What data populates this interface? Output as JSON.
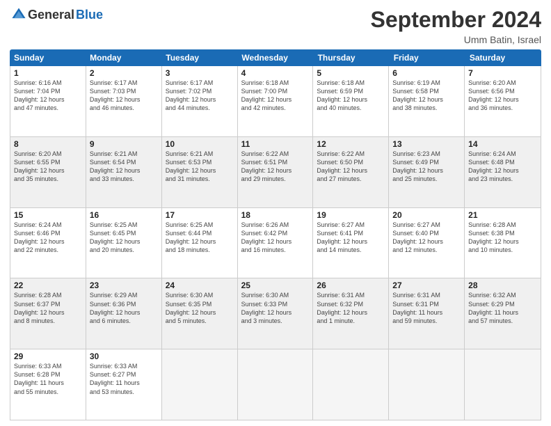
{
  "logo": {
    "general": "General",
    "blue": "Blue"
  },
  "title": "September 2024",
  "location": "Umm Batin, Israel",
  "header_days": [
    "Sunday",
    "Monday",
    "Tuesday",
    "Wednesday",
    "Thursday",
    "Friday",
    "Saturday"
  ],
  "rows": [
    [
      {
        "day": "1",
        "info": "Sunrise: 6:16 AM\nSunset: 7:04 PM\nDaylight: 12 hours\nand 47 minutes."
      },
      {
        "day": "2",
        "info": "Sunrise: 6:17 AM\nSunset: 7:03 PM\nDaylight: 12 hours\nand 46 minutes."
      },
      {
        "day": "3",
        "info": "Sunrise: 6:17 AM\nSunset: 7:02 PM\nDaylight: 12 hours\nand 44 minutes."
      },
      {
        "day": "4",
        "info": "Sunrise: 6:18 AM\nSunset: 7:00 PM\nDaylight: 12 hours\nand 42 minutes."
      },
      {
        "day": "5",
        "info": "Sunrise: 6:18 AM\nSunset: 6:59 PM\nDaylight: 12 hours\nand 40 minutes."
      },
      {
        "day": "6",
        "info": "Sunrise: 6:19 AM\nSunset: 6:58 PM\nDaylight: 12 hours\nand 38 minutes."
      },
      {
        "day": "7",
        "info": "Sunrise: 6:20 AM\nSunset: 6:56 PM\nDaylight: 12 hours\nand 36 minutes."
      }
    ],
    [
      {
        "day": "8",
        "info": "Sunrise: 6:20 AM\nSunset: 6:55 PM\nDaylight: 12 hours\nand 35 minutes."
      },
      {
        "day": "9",
        "info": "Sunrise: 6:21 AM\nSunset: 6:54 PM\nDaylight: 12 hours\nand 33 minutes."
      },
      {
        "day": "10",
        "info": "Sunrise: 6:21 AM\nSunset: 6:53 PM\nDaylight: 12 hours\nand 31 minutes."
      },
      {
        "day": "11",
        "info": "Sunrise: 6:22 AM\nSunset: 6:51 PM\nDaylight: 12 hours\nand 29 minutes."
      },
      {
        "day": "12",
        "info": "Sunrise: 6:22 AM\nSunset: 6:50 PM\nDaylight: 12 hours\nand 27 minutes."
      },
      {
        "day": "13",
        "info": "Sunrise: 6:23 AM\nSunset: 6:49 PM\nDaylight: 12 hours\nand 25 minutes."
      },
      {
        "day": "14",
        "info": "Sunrise: 6:24 AM\nSunset: 6:48 PM\nDaylight: 12 hours\nand 23 minutes."
      }
    ],
    [
      {
        "day": "15",
        "info": "Sunrise: 6:24 AM\nSunset: 6:46 PM\nDaylight: 12 hours\nand 22 minutes."
      },
      {
        "day": "16",
        "info": "Sunrise: 6:25 AM\nSunset: 6:45 PM\nDaylight: 12 hours\nand 20 minutes."
      },
      {
        "day": "17",
        "info": "Sunrise: 6:25 AM\nSunset: 6:44 PM\nDaylight: 12 hours\nand 18 minutes."
      },
      {
        "day": "18",
        "info": "Sunrise: 6:26 AM\nSunset: 6:42 PM\nDaylight: 12 hours\nand 16 minutes."
      },
      {
        "day": "19",
        "info": "Sunrise: 6:27 AM\nSunset: 6:41 PM\nDaylight: 12 hours\nand 14 minutes."
      },
      {
        "day": "20",
        "info": "Sunrise: 6:27 AM\nSunset: 6:40 PM\nDaylight: 12 hours\nand 12 minutes."
      },
      {
        "day": "21",
        "info": "Sunrise: 6:28 AM\nSunset: 6:38 PM\nDaylight: 12 hours\nand 10 minutes."
      }
    ],
    [
      {
        "day": "22",
        "info": "Sunrise: 6:28 AM\nSunset: 6:37 PM\nDaylight: 12 hours\nand 8 minutes."
      },
      {
        "day": "23",
        "info": "Sunrise: 6:29 AM\nSunset: 6:36 PM\nDaylight: 12 hours\nand 6 minutes."
      },
      {
        "day": "24",
        "info": "Sunrise: 6:30 AM\nSunset: 6:35 PM\nDaylight: 12 hours\nand 5 minutes."
      },
      {
        "day": "25",
        "info": "Sunrise: 6:30 AM\nSunset: 6:33 PM\nDaylight: 12 hours\nand 3 minutes."
      },
      {
        "day": "26",
        "info": "Sunrise: 6:31 AM\nSunset: 6:32 PM\nDaylight: 12 hours\nand 1 minute."
      },
      {
        "day": "27",
        "info": "Sunrise: 6:31 AM\nSunset: 6:31 PM\nDaylight: 11 hours\nand 59 minutes."
      },
      {
        "day": "28",
        "info": "Sunrise: 6:32 AM\nSunset: 6:29 PM\nDaylight: 11 hours\nand 57 minutes."
      }
    ],
    [
      {
        "day": "29",
        "info": "Sunrise: 6:33 AM\nSunset: 6:28 PM\nDaylight: 11 hours\nand 55 minutes."
      },
      {
        "day": "30",
        "info": "Sunrise: 6:33 AM\nSunset: 6:27 PM\nDaylight: 11 hours\nand 53 minutes."
      },
      {
        "day": "",
        "info": "",
        "empty": true
      },
      {
        "day": "",
        "info": "",
        "empty": true
      },
      {
        "day": "",
        "info": "",
        "empty": true
      },
      {
        "day": "",
        "info": "",
        "empty": true
      },
      {
        "day": "",
        "info": "",
        "empty": true
      }
    ]
  ]
}
